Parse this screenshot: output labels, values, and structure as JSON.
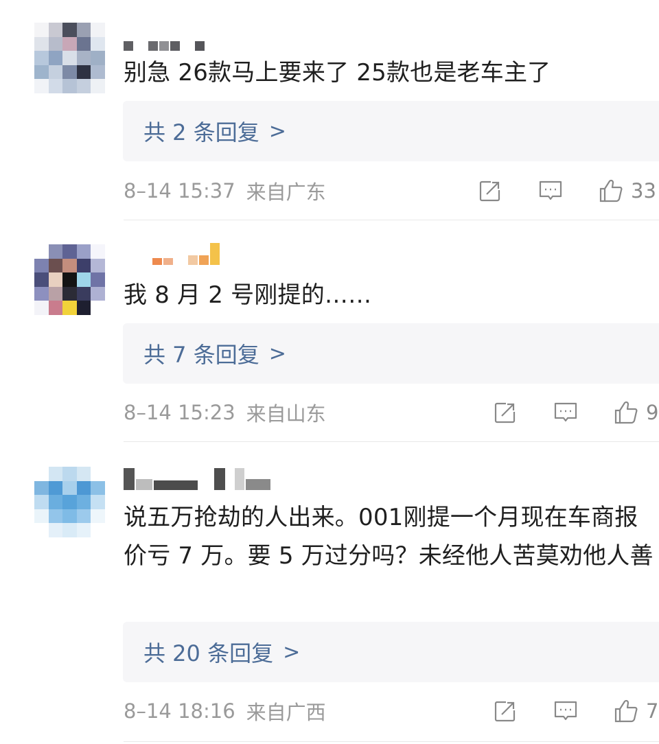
{
  "comments": [
    {
      "text": "别急 26款马上要来了 25款也是老车主了",
      "reply_label": "共 2 条回复",
      "chevron": ">",
      "time": "8–14 15:37",
      "location": "来自广东",
      "likes": "33"
    },
    {
      "text": "我 8 月 2 号刚提的……",
      "reply_label": "共 7 条回复",
      "chevron": ">",
      "time": "8–14 15:23",
      "location": "来自山东",
      "likes": "9"
    },
    {
      "text": "说五万抢劫的人出来。001刚提一个月现在车商报价亏 7 万。要 5 万过分吗？未经他人苦莫劝他人善",
      "reply_label": "共 20 条回复",
      "chevron": ">",
      "time": "8–14 18:16",
      "location": "来自广西",
      "likes": "7"
    }
  ],
  "icons": {
    "share": "share-icon",
    "comment": "comment-icon",
    "like": "thumbs-up-icon"
  },
  "colors": {
    "reply_link": "#4c6c97",
    "reply_bg": "#f6f6f8",
    "meta_text": "#9a9a9a",
    "body_text": "#1f1f1f"
  }
}
